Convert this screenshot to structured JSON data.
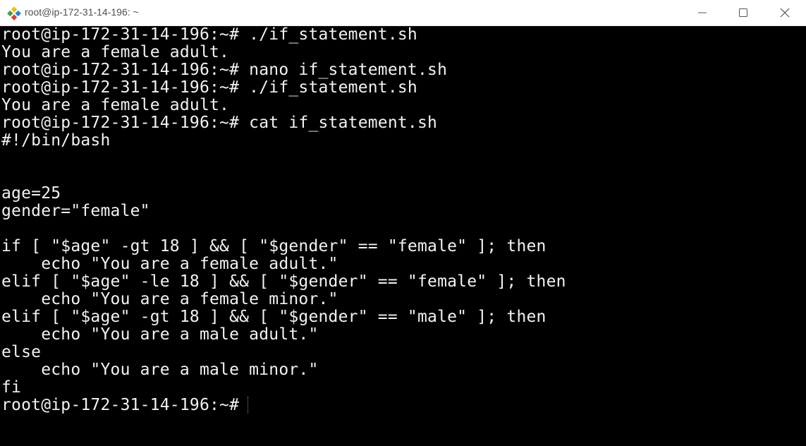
{
  "window": {
    "title": "root@ip-172-31-14-196: ~",
    "icons": {
      "app": "app-icon",
      "minimize": "minimize-icon",
      "maximize": "maximize-icon",
      "close": "close-icon"
    }
  },
  "terminal": {
    "lines": [
      "root@ip-172-31-14-196:~# ./if_statement.sh",
      "You are a female adult.",
      "root@ip-172-31-14-196:~# nano if_statement.sh",
      "root@ip-172-31-14-196:~# ./if_statement.sh",
      "You are a female adult.",
      "root@ip-172-31-14-196:~# cat if_statement.sh",
      "#!/bin/bash",
      "",
      "",
      "age=25",
      "gender=\"female\"",
      "",
      "if [ \"$age\" -gt 18 ] && [ \"$gender\" == \"female\" ]; then",
      "    echo \"You are a female adult.\"",
      "elif [ \"$age\" -le 18 ] && [ \"$gender\" == \"female\" ]; then",
      "    echo \"You are a female minor.\"",
      "elif [ \"$age\" -gt 18 ] && [ \"$gender\" == \"male\" ]; then",
      "    echo \"You are a male adult.\"",
      "else",
      "    echo \"You are a male minor.\"",
      "fi",
      "root@ip-172-31-14-196:~# "
    ]
  },
  "colors": {
    "terminal_bg": "#000000",
    "terminal_fg": "#f2f2f2",
    "titlebar_bg": "#ffffff"
  }
}
